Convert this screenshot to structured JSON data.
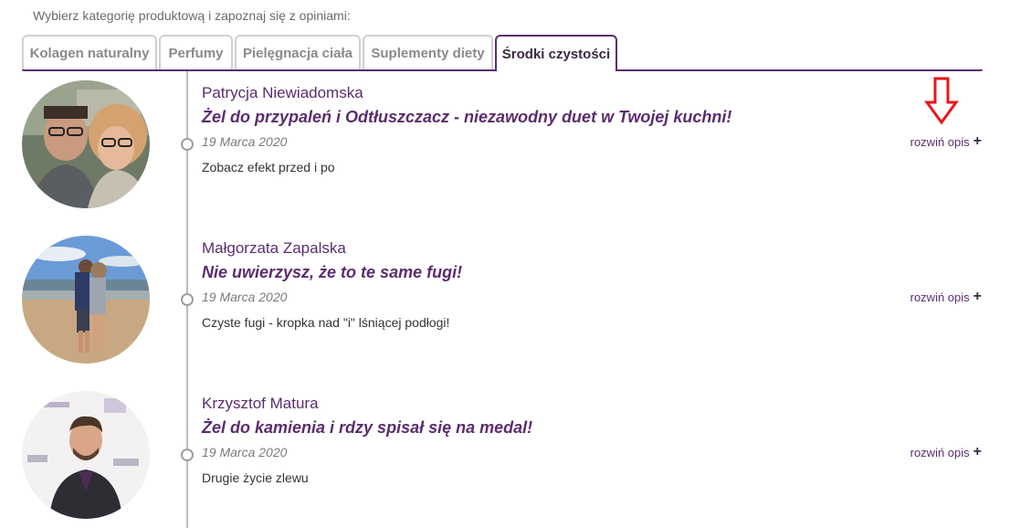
{
  "intro": "Wybierz kategorię produktową i zapoznaj się z opiniami:",
  "tabs": [
    {
      "label": "Kolagen naturalny"
    },
    {
      "label": "Perfumy"
    },
    {
      "label": "Pielęgnacja ciała"
    },
    {
      "label": "Suplementy diety"
    },
    {
      "label": "Środki czystości"
    }
  ],
  "active_tab": "Środki czystości",
  "reviews": [
    {
      "author": "Patrycja Niewiadomska",
      "headline": "Żel do przypaleń i Odtłuszczacz - niezawodny duet w Twojej kuchni!",
      "date": "19 Marca 2020",
      "description": "Zobacz efekt przed i po",
      "expand_label": "rozwiń opis",
      "expand_icon": "+"
    },
    {
      "author": "Małgorzata Zapalska",
      "headline": "Nie uwierzysz, że to te same fugi!",
      "date": "19 Marca 2020",
      "description": "Czyste fugi - kropka nad \"i\" lśniącej podłogi!",
      "expand_label": "rozwiń opis",
      "expand_icon": "+"
    },
    {
      "author": "Krzysztof Matura",
      "headline": "Żel do kamienia i rdzy spisał się na medal!",
      "date": "19 Marca 2020",
      "description": "Drugie życie zlewu",
      "expand_label": "rozwiń opis",
      "expand_icon": "+"
    }
  ],
  "colors": {
    "accent": "#5b2d6e",
    "annotation_arrow": "#e8161b"
  }
}
